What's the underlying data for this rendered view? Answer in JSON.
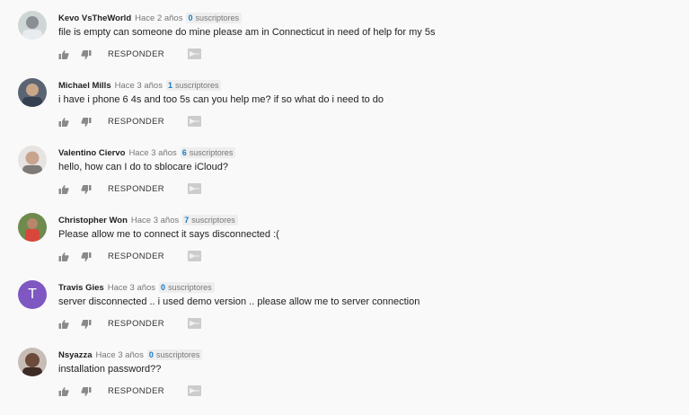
{
  "reply_label": "RESPONDER",
  "subs_suffix": "suscriptores",
  "comments": [
    {
      "author": "Kevo VsTheWorld",
      "time": "Hace 2 años",
      "subs": "0",
      "text": "file is empty can someone do mine please am in Connecticut in need of help for my 5s",
      "avatar": "photo-avatar"
    },
    {
      "author": "Michael Mills",
      "time": "Hace 3 años",
      "subs": "1",
      "text": "i have i phone 6 4s and too 5s can you help me? if so what do i need to do",
      "avatar": "photo-avatar"
    },
    {
      "author": "Valentino Ciervo",
      "time": "Hace 3 años",
      "subs": "6",
      "text": "hello, how can I do to sblocare iCloud?",
      "avatar": "photo-avatar"
    },
    {
      "author": "Christopher Won",
      "time": "Hace 3 años",
      "subs": "7",
      "text": "Please allow me to connect it says disconnected :(",
      "avatar": "photo-avatar"
    },
    {
      "author": "Travis Gies",
      "time": "Hace 3 años",
      "subs": "0",
      "text": "server disconnected .. i used demo version .. please allow me to server connection",
      "avatar_letter": "T",
      "avatar_color": "#7e57c2"
    },
    {
      "author": "Nsyazza",
      "time": "Hace 3 años",
      "subs": "0",
      "text": "installation password??",
      "avatar": "photo-avatar"
    }
  ]
}
